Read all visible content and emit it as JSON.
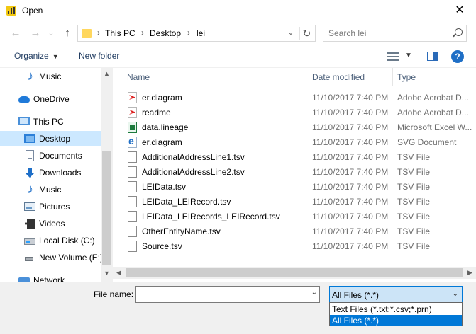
{
  "window": {
    "title": "Open",
    "close_glyph": "✕"
  },
  "navigation": {
    "back_icon": "←",
    "forward_icon": "→",
    "recent_icon": "⌄",
    "up_icon": "↑",
    "breadcrumb": [
      "This PC",
      "Desktop",
      "lei"
    ],
    "separator": "›",
    "dropdown_icon": "⌄",
    "refresh_icon": "↻"
  },
  "search": {
    "placeholder": "Search lei"
  },
  "toolbar": {
    "organize_label": "Organize",
    "new_folder_label": "New folder",
    "help_label": "?",
    "caret": "▼"
  },
  "sidebar": {
    "items": [
      {
        "label": "Music",
        "icon": "music-icon"
      },
      {
        "label": "OneDrive",
        "icon": "onedrive-icon"
      },
      {
        "label": "This PC",
        "icon": "pc-icon"
      },
      {
        "label": "Desktop",
        "icon": "desktop-icon",
        "selected": true
      },
      {
        "label": "Documents",
        "icon": "documents-icon"
      },
      {
        "label": "Downloads",
        "icon": "downloads-icon"
      },
      {
        "label": "Music",
        "icon": "music-icon"
      },
      {
        "label": "Pictures",
        "icon": "pictures-icon"
      },
      {
        "label": "Videos",
        "icon": "videos-icon"
      },
      {
        "label": "Local Disk (C:)",
        "icon": "local-disk-icon"
      },
      {
        "label": "New Volume (E:)",
        "icon": "usb-drive-icon"
      },
      {
        "label": "Network",
        "icon": "network-icon"
      }
    ]
  },
  "file_list": {
    "columns": {
      "name": "Name",
      "date": "Date modified",
      "type": "Type"
    },
    "rows": [
      {
        "name": "er.diagram",
        "date": "11/10/2017 7:40 PM",
        "type": "Adobe Acrobat D...",
        "icon": "pdf-file-icon"
      },
      {
        "name": "readme",
        "date": "11/10/2017 7:40 PM",
        "type": "Adobe Acrobat D...",
        "icon": "pdf-file-icon"
      },
      {
        "name": "data.lineage",
        "date": "11/10/2017 7:40 PM",
        "type": "Microsoft Excel W...",
        "icon": "excel-file-icon"
      },
      {
        "name": "er.diagram",
        "date": "11/10/2017 7:40 PM",
        "type": "SVG Document",
        "icon": "svg-file-icon"
      },
      {
        "name": "AdditionalAddressLine1.tsv",
        "date": "11/10/2017 7:40 PM",
        "type": "TSV File",
        "icon": "tsv-file-icon"
      },
      {
        "name": "AdditionalAddressLine2.tsv",
        "date": "11/10/2017 7:40 PM",
        "type": "TSV File",
        "icon": "tsv-file-icon"
      },
      {
        "name": "LEIData.tsv",
        "date": "11/10/2017 7:40 PM",
        "type": "TSV File",
        "icon": "tsv-file-icon"
      },
      {
        "name": "LEIData_LEIRecord.tsv",
        "date": "11/10/2017 7:40 PM",
        "type": "TSV File",
        "icon": "tsv-file-icon"
      },
      {
        "name": "LEIData_LEIRecords_LEIRecord.tsv",
        "date": "11/10/2017 7:40 PM",
        "type": "TSV File",
        "icon": "tsv-file-icon"
      },
      {
        "name": "OtherEntityName.tsv",
        "date": "11/10/2017 7:40 PM",
        "type": "TSV File",
        "icon": "tsv-file-icon"
      },
      {
        "name": "Source.tsv",
        "date": "11/10/2017 7:40 PM",
        "type": "TSV File",
        "icon": "tsv-file-icon"
      }
    ]
  },
  "bottom": {
    "file_name_label": "File name:",
    "file_name_value": "",
    "file_type_selected": "All Files (*.*)",
    "file_type_options": [
      "Text Files (*.txt;*.csv;*.prn)",
      "All Files (*.*)"
    ]
  },
  "colors": {
    "selection": "#cce8ff",
    "accent": "#0078d7",
    "help": "#1f6fc6"
  }
}
